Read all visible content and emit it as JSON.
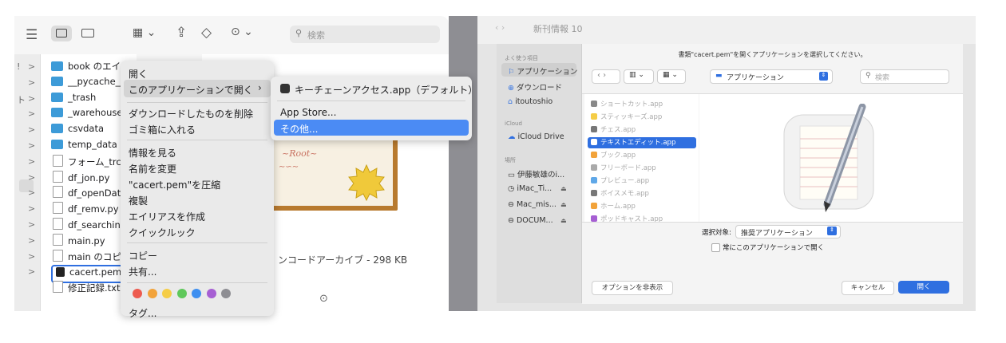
{
  "finder": {
    "toolbar_icons": [
      "list-icon",
      "columns-icon",
      "gallery-icon",
      "group-icon",
      "share-icon",
      "tag-icon",
      "more-icon"
    ],
    "search_placeholder": "検索",
    "sidebar_chevrons": [
      ">",
      ">",
      ">",
      ">",
      ">",
      ">",
      ">",
      ">",
      ">",
      ">",
      ">",
      ">",
      ">",
      ">"
    ],
    "sidebar_labels": [
      "!",
      "",
      "ト"
    ],
    "files": [
      {
        "name": "book のエイリ",
        "type": "folder-alias"
      },
      {
        "name": "__pycache__",
        "type": "folder"
      },
      {
        "name": "_trash",
        "type": "folder"
      },
      {
        "name": "_warehouse",
        "type": "folder"
      },
      {
        "name": "csvdata",
        "type": "folder"
      },
      {
        "name": "temp_data",
        "type": "folder"
      },
      {
        "name": "フォーム_trc_",
        "type": "doc"
      },
      {
        "name": "df_jon.py",
        "type": "doc"
      },
      {
        "name": "df_openData",
        "type": "doc"
      },
      {
        "name": "df_remv.py",
        "type": "doc"
      },
      {
        "name": "df_searching",
        "type": "doc"
      },
      {
        "name": "main.py",
        "type": "doc"
      },
      {
        "name": "main のコピー",
        "type": "doc"
      },
      {
        "name": "cacert.pem",
        "type": "pem"
      },
      {
        "name": "修正記録.txt",
        "type": "doc"
      }
    ],
    "preview_caption": "ンコードアーカイブ - 298 KB",
    "preview_more": "⊙"
  },
  "context_menu": {
    "open": "開く",
    "open_with": "このアプリケーションで開く",
    "delete_download": "ダウンロードしたものを削除",
    "trash": "ゴミ箱に入れる",
    "get_info": "情報を見る",
    "rename": "名前を変更",
    "compress": "\"cacert.pem\"を圧縮",
    "duplicate": "複製",
    "alias": "エイリアスを作成",
    "quicklook": "クイックルック",
    "copy": "コピー",
    "share": "共有...",
    "tags": "タグ...",
    "tag_colors": [
      "#ed5b4f",
      "#f2a33a",
      "#f5cd47",
      "#5fc85b",
      "#3e8ff0",
      "#a65fd3",
      "#8e8e93"
    ]
  },
  "submenu": {
    "default_app": "キーチェーンアクセス.app（デフォルト）",
    "app_store": "App Store...",
    "other": "その他..."
  },
  "dialog": {
    "bg_title": "新刊情報 10",
    "prompt": "書類\"cacert.pem\"を開くアプリケーションを選択してください。",
    "location": "アプリケーション",
    "search_placeholder": "検索",
    "sidebar": {
      "favorites_header": "よく使う項目",
      "favorites": [
        "アプリケーション",
        "ダウンロード",
        "itoutoshio"
      ],
      "icloud_header": "iCloud",
      "icloud": [
        "iCloud Drive"
      ],
      "locations_header": "場所",
      "locations": [
        "伊藤敏雄のi...",
        "iMac_Ti...",
        "Mac_mis...",
        "DOCUM..."
      ]
    },
    "apps": [
      "ショートカット.app",
      "スティッキーズ.app",
      "チェス.app",
      "テキストエディット.app",
      "ブック.app",
      "フリーボード.app",
      "プレビュー.app",
      "ボイスメモ.app",
      "ホーム.app",
      "ポッドキャスト.app"
    ],
    "selected_app": "テキストエディット.app",
    "enable_label": "選択対象:",
    "enable_value": "推奨アプリケーション",
    "always_open": "常にこのアプリケーションで開く",
    "options_btn": "オプションを非表示",
    "cancel_btn": "キャンセル",
    "open_btn": "開く"
  },
  "colors": {
    "accent": "#2f6fe0",
    "menu_highlight": "#4b8bf4",
    "folder": "#3d9bd8"
  }
}
